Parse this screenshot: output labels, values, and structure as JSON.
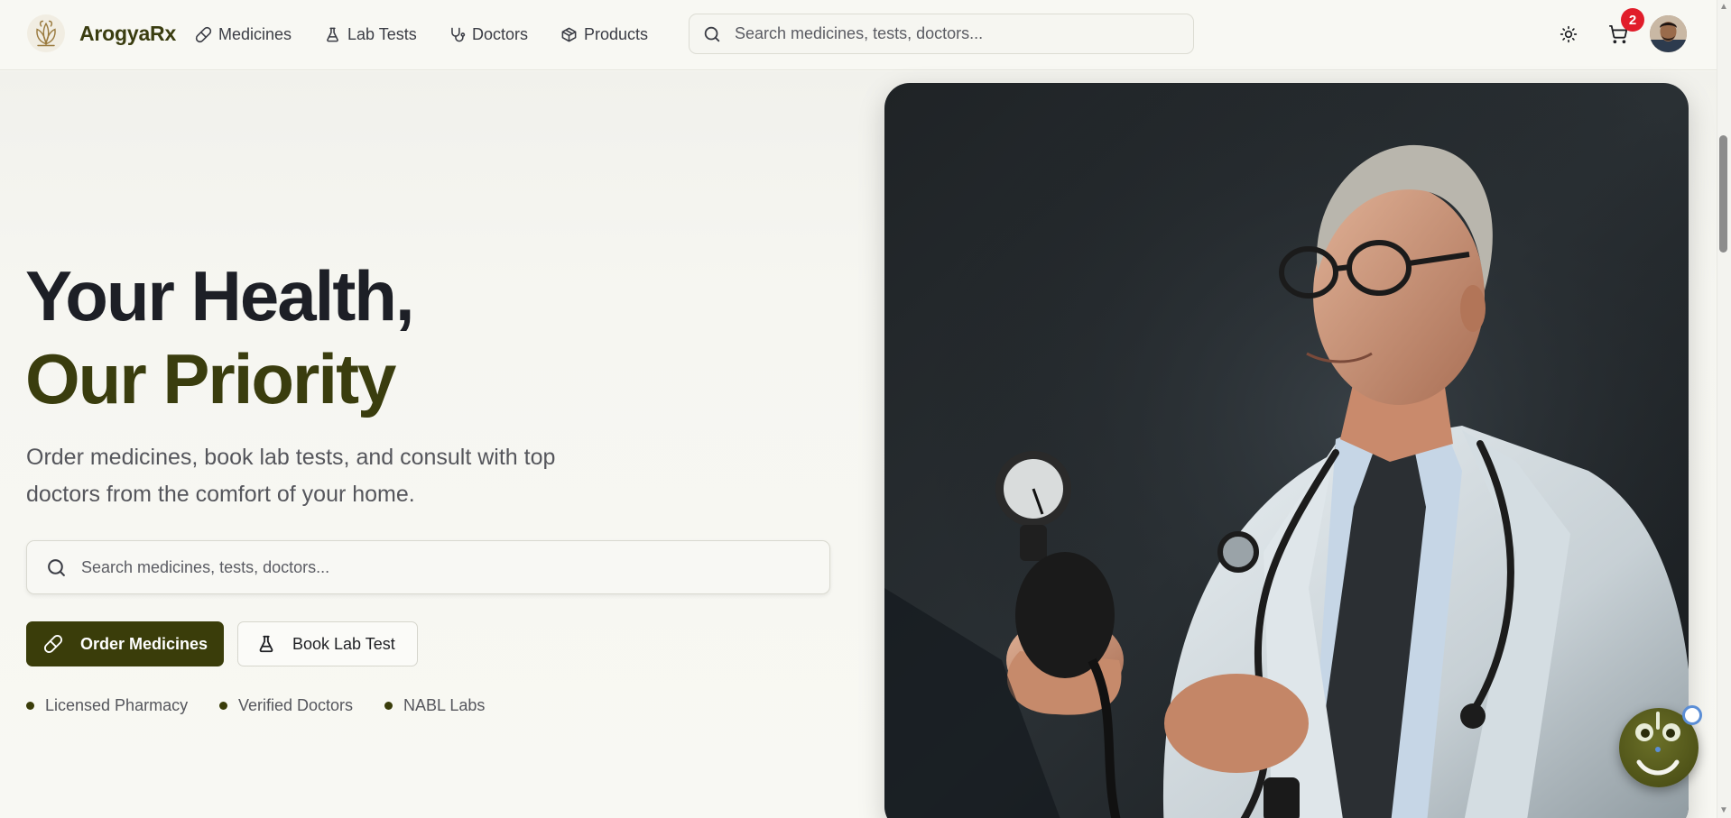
{
  "brand": {
    "name": "ArogyaRx",
    "logo": "lotus-logo"
  },
  "nav": {
    "items": [
      {
        "label": "Medicines",
        "icon": "pill-icon"
      },
      {
        "label": "Lab Tests",
        "icon": "flask-icon"
      },
      {
        "label": "Doctors",
        "icon": "stethoscope-icon"
      },
      {
        "label": "Products",
        "icon": "box-icon"
      }
    ]
  },
  "header_search": {
    "placeholder": "Search medicines, tests, doctors..."
  },
  "header_actions": {
    "theme_icon": "sun-icon",
    "cart_icon": "cart-icon",
    "cart_count": "2"
  },
  "hero": {
    "title_line1": "Your Health,",
    "title_line2": "Our Priority",
    "subtitle": "Order medicines, book lab tests, and consult with top doctors from the comfort of your home.",
    "search": {
      "placeholder": "Search medicines, tests, doctors..."
    },
    "primary_cta": "Order Medicines",
    "secondary_cta": "Book Lab Test",
    "trust": [
      "Licensed Pharmacy",
      "Verified Doctors",
      "NABL Labs"
    ]
  },
  "colors": {
    "brand_olive": "#3a3d0a",
    "badge_red": "#e11d2a",
    "background": "#f7f7f2",
    "text_dark": "#1f2024",
    "text_muted": "#55565c"
  }
}
